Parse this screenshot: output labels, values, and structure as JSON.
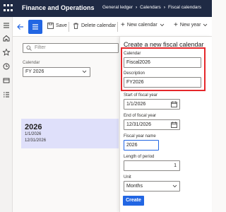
{
  "header": {
    "app_title": "Finance and Operations",
    "breadcrumbs": [
      "General ledger",
      "Calendars",
      "Fiscal calendars"
    ]
  },
  "leftnav": {
    "icons": [
      "hamburger-icon",
      "home-icon",
      "star-icon",
      "clock-icon",
      "workspace-icon",
      "list-icon"
    ]
  },
  "toolbar": {
    "save_label": "Save",
    "delete_label": "Delete calendar",
    "new_calendar_label": "New calendar",
    "new_year_label": "New year"
  },
  "list_pane": {
    "filter_placeholder": "Filter",
    "calendar_label": "Calendar",
    "calendar_value": "FY 2026",
    "selected_year": {
      "year": "2026",
      "start": "1/1/2026",
      "end": "12/31/2026"
    }
  },
  "panel": {
    "title": "Create a new fiscal calendar",
    "calendar_label": "Calendar",
    "calendar_value": "Fiscal2026",
    "description_label": "Description",
    "description_value": "FY2026",
    "start_label": "Start of fiscal year",
    "start_value": "1/1/2026",
    "end_label": "End of fiscal year",
    "end_value": "12/31/2026",
    "year_name_label": "Fiscal year name",
    "year_name_value": "2026",
    "length_label": "Length of period",
    "length_value": "1",
    "unit_label": "Unit",
    "unit_value": "Months",
    "create_label": "Create"
  },
  "colors": {
    "topbar": "#1f2a44",
    "accent": "#2266e3",
    "selected_row": "#dfe0fa",
    "highlight_box": "#e5272b"
  }
}
